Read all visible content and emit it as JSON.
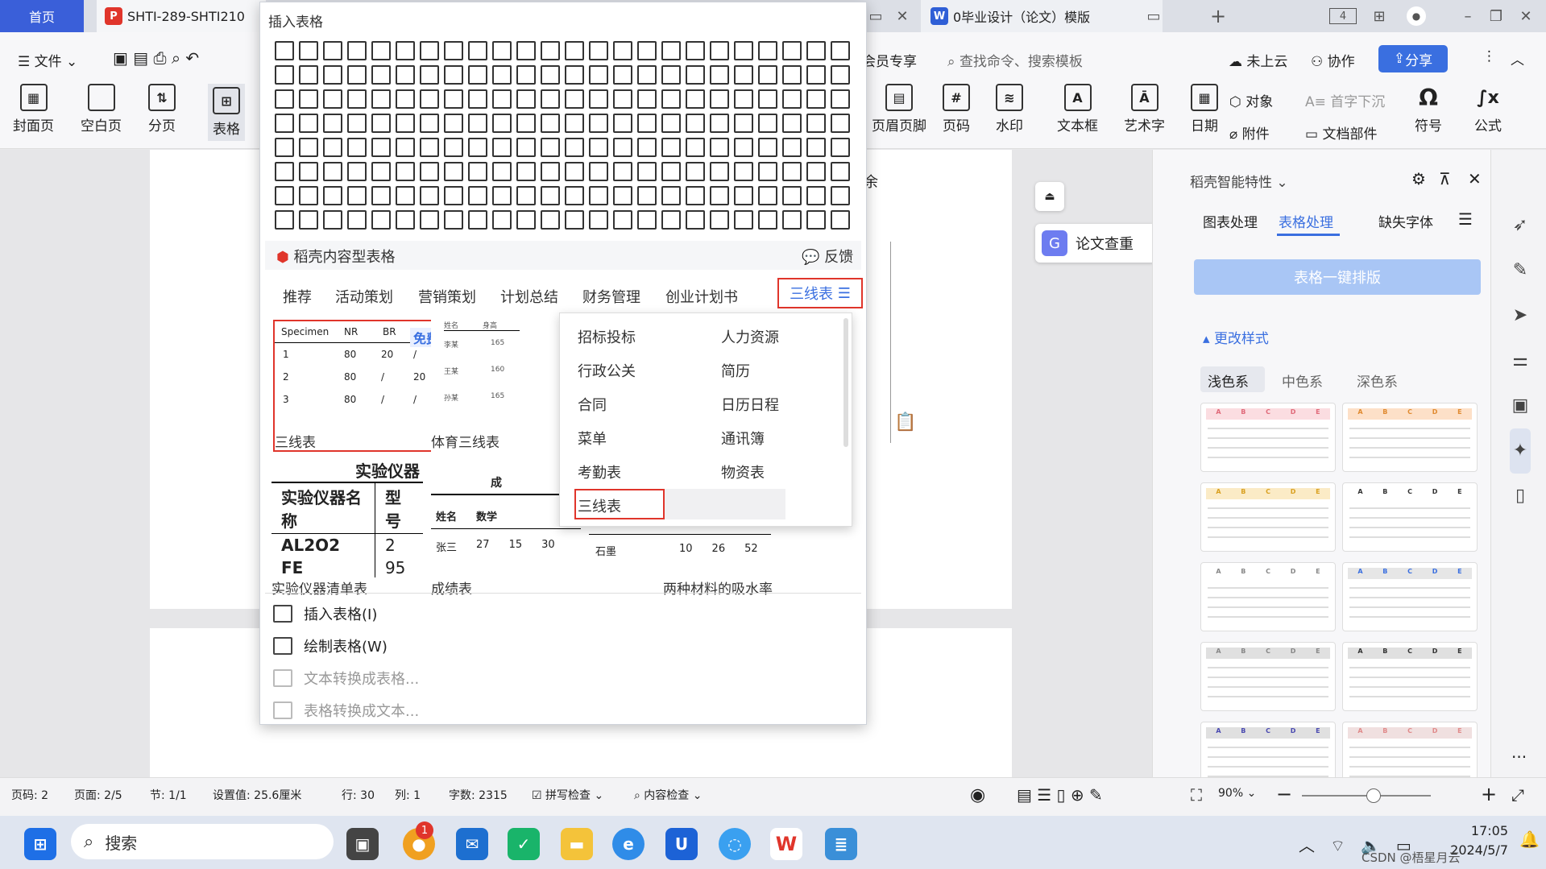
{
  "tabs": {
    "home": "首页",
    "pdf": "SHTI-289-SHTI210",
    "doc": "0毕业设计（论文）模版"
  },
  "menu": {
    "file": "文件",
    "vip": "会员专享",
    "search_placeholder": "查找命令、搜索模板",
    "cloud": "未上云",
    "collab": "协作",
    "share": "分享"
  },
  "ribbon": {
    "cover": "封面页",
    "blank": "空白页",
    "break": "分页",
    "table": "表格",
    "header": "页眉页脚",
    "pagenum": "页码",
    "watermark": "水印",
    "textbox": "文本框",
    "art": "艺术字",
    "date": "日期",
    "object": "对象",
    "attach": "附件",
    "dropcap": "首字下沉",
    "docpart": "文档部件",
    "symbol": "符号",
    "formula": "公式"
  },
  "popup": {
    "title": "插入表格",
    "section": "稻壳内容型表格",
    "feedback": "反馈",
    "categories": [
      "推荐",
      "活动策划",
      "营销策划",
      "计划总结",
      "财务管理",
      "创业计划书"
    ],
    "more": "三线表",
    "dropdown": [
      [
        "招标投标",
        "人力资源"
      ],
      [
        "行政公关",
        "简历"
      ],
      [
        "合同",
        "日历日程"
      ],
      [
        "菜单",
        "通讯簿"
      ],
      [
        "考勤表",
        "物资表"
      ],
      [
        "三线表",
        ""
      ]
    ],
    "t1": {
      "headers": [
        "Specimen",
        "NR",
        "BR"
      ],
      "rows": [
        [
          "1",
          "80",
          "20",
          "/"
        ],
        [
          "2",
          "80",
          "/",
          "20"
        ],
        [
          "3",
          "80",
          "/",
          "/"
        ]
      ],
      "free": "免费",
      "label": "三线表"
    },
    "t2": {
      "label": "体育三线表",
      "header": [
        "姓名",
        "身高"
      ],
      "rows": [
        [
          "李某",
          "165"
        ],
        [
          "王某",
          "160"
        ],
        [
          "孙某",
          "165"
        ]
      ]
    },
    "t3": {
      "title": "实验仪器",
      "h1": "实验仪器名称",
      "h2": "型号",
      "r1a": "AL2O2",
      "r1b": "2",
      "r2a": "FE",
      "r2b": "95",
      "label": "实验仪器清单表"
    },
    "t4": {
      "title": "成",
      "h1": "姓名",
      "h2": "数学",
      "r": [
        "张三",
        "27",
        "15",
        "30"
      ],
      "label": "成绩表"
    },
    "t5": {
      "r": [
        "石墨",
        "10",
        "26",
        "52"
      ],
      "label": "两种材料的吸水率"
    },
    "menu": {
      "insert": "插入表格(I)",
      "draw": "绘制表格(W)",
      "t2t": "文本转换成表格...",
      "tab2t": "表格转换成文本..."
    }
  },
  "doc": {
    "check": "论文查重",
    "fragment": "余"
  },
  "side": {
    "title": "稻壳智能特性",
    "tabs": [
      "图表处理",
      "表格处理",
      "缺失字体"
    ],
    "onekey": "表格一键排版",
    "change": "更改样式",
    "tones": [
      "浅色系",
      "中色系",
      "深色系"
    ],
    "cols": [
      "A",
      "B",
      "C",
      "D",
      "E"
    ]
  },
  "status": {
    "page": "页码: 2",
    "pages": "页面: 2/5",
    "section": "节: 1/1",
    "setting": "设置值: 25.6厘米",
    "line": "行: 30",
    "col": "列: 1",
    "words": "字数: 2315",
    "spell": "拼写检查",
    "content": "内容检查",
    "zoom": "90%"
  },
  "taskbar": {
    "search": "搜索",
    "time": "17:05",
    "date": "2024/5/7",
    "badge": "1",
    "watermark": "CSDN @梧星月云"
  },
  "colors": {
    "accent": "#3a6fe0",
    "red": "#e0352b"
  }
}
